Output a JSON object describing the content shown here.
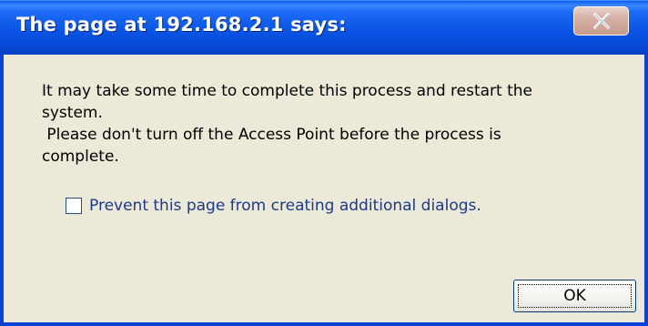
{
  "dialog": {
    "title": "The page at 192.168.2.1 says:",
    "message": "It may take some time to complete this process and restart the\nsystem.\n Please don't turn off the Access Point before the process is\ncomplete.",
    "prevent_checkbox": {
      "label": "Prevent this page from creating additional dialogs.",
      "checked": false
    },
    "ok_label": "OK",
    "close_icon": "close-icon"
  },
  "colors": {
    "titlebar": "#0a55e6",
    "frame": "#0843d6",
    "body": "#ece9d8",
    "close_button": "#d7b3a8"
  }
}
